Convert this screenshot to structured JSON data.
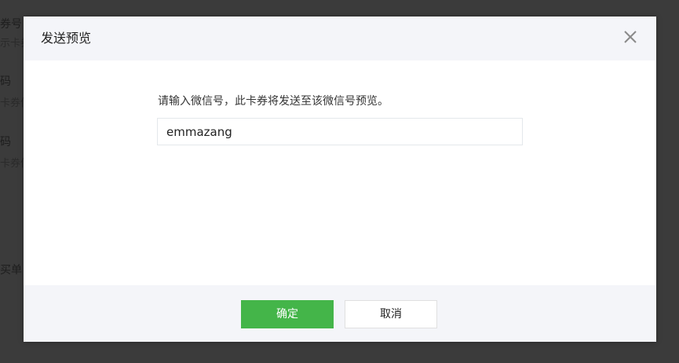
{
  "background": {
    "fragments": [
      {
        "text": "券号",
        "kind": "label"
      },
      {
        "text": "示卡券",
        "kind": "sub"
      },
      {
        "text": "码",
        "kind": "label"
      },
      {
        "text": "卡券信",
        "kind": "sub"
      },
      {
        "text": "码",
        "kind": "label"
      },
      {
        "text": "卡券信",
        "kind": "sub"
      },
      {
        "text": "买单",
        "kind": "label"
      }
    ]
  },
  "dialog": {
    "title": "发送预览",
    "close_icon": "close-icon",
    "prompt": "请输入微信号，此卡券将发送至该微信号预览。",
    "input": {
      "value": "emmazang",
      "placeholder": ""
    },
    "buttons": {
      "confirm_label": "确定",
      "cancel_label": "取消"
    }
  },
  "colors": {
    "primary": "#44b549",
    "overlay": "#3b3b3b",
    "header_bg": "#f4f5f9"
  }
}
